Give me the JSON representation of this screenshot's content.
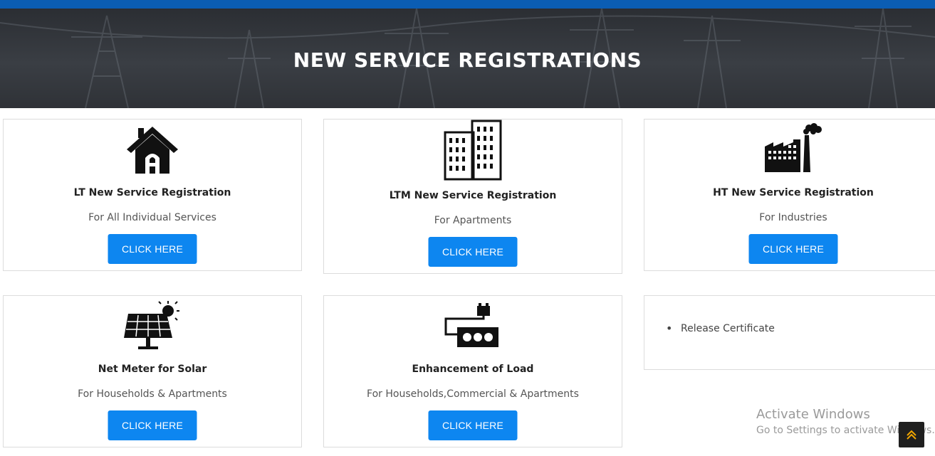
{
  "header": {
    "title": "NEW SERVICE REGISTRATIONS"
  },
  "cards": [
    {
      "icon": "house-icon",
      "title": "LT New Service Registration",
      "subtitle": "For All Individual Services",
      "button": "CLICK HERE"
    },
    {
      "icon": "apartment-building-icon",
      "title": "LTM New Service Registration",
      "subtitle": "For Apartments",
      "button": "CLICK HERE"
    },
    {
      "icon": "factory-icon",
      "title": "HT New Service Registration",
      "subtitle": "For Industries",
      "button": "CLICK HERE"
    },
    {
      "icon": "solar-panel-icon",
      "title": "Net Meter for Solar",
      "subtitle": "For Households & Apartments",
      "button": "CLICK HERE"
    },
    {
      "icon": "load-meter-icon",
      "title": "Enhancement of Load",
      "subtitle": "For Households,Commercial & Apartments",
      "button": "CLICK HERE"
    }
  ],
  "links_card": {
    "items": [
      "Release Certificate"
    ]
  },
  "watermark": {
    "line1": "Activate Windows",
    "line2": "Go to Settings to activate Windows."
  },
  "colors": {
    "accent": "#0d86f0",
    "topbar": "#0b5db3",
    "hero_bg": "#33363b"
  }
}
